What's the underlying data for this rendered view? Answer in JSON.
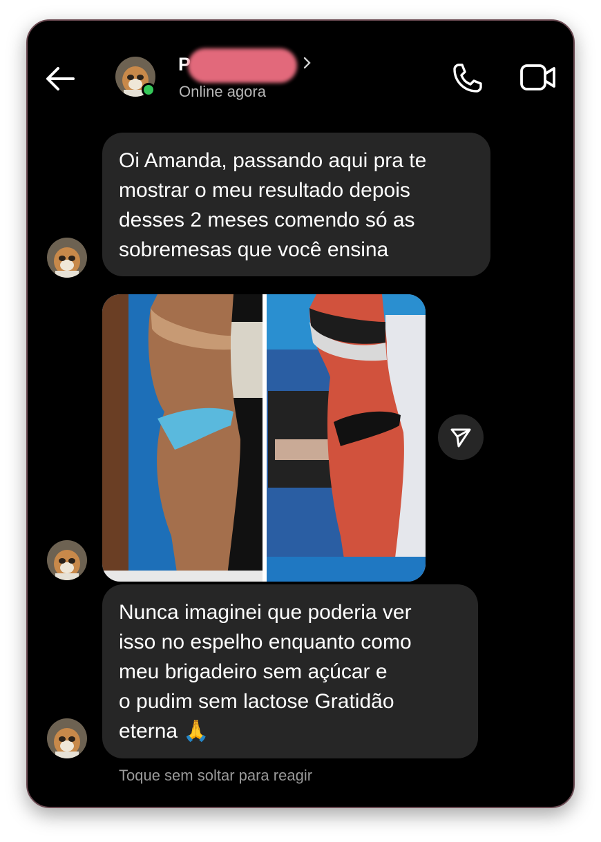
{
  "header": {
    "contact_name": "P",
    "status": "Online agora"
  },
  "messages": [
    {
      "text": "Oi Amanda, passando aqui pra te\nmostrar o meu resultado depois\ndesses 2 meses comendo só as\nsobremesas que você ensina"
    },
    {
      "type": "image"
    },
    {
      "text": "Nunca imaginei que poderia ver\nisso no espelho enquanto como\nmeu brigadeiro sem açúcar e\no pudim sem lactose Gratidão\neterna 🙏"
    }
  ],
  "footer": {
    "hint": "Toque sem soltar para reagir"
  },
  "icons": [
    "back-arrow-icon",
    "avatar",
    "chevron-right-icon",
    "phone-icon",
    "video-camera-icon",
    "send-icon"
  ],
  "colors": {
    "background": "#000000",
    "bubble": "#262626",
    "online": "#35c759",
    "text": "#ffffff",
    "muted": "#b7b7b7"
  }
}
